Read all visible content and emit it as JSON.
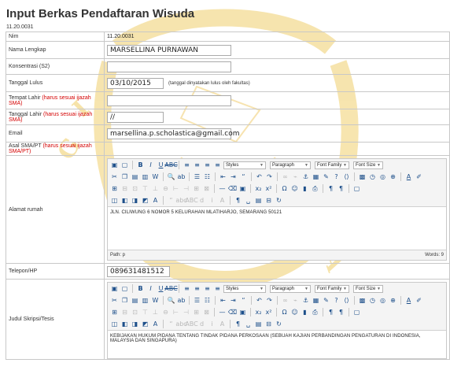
{
  "page": {
    "title": "Input Berkas Pendaftaran Wisuda",
    "id_line": "11.20.0031"
  },
  "form": {
    "nim": {
      "label": "Nim",
      "value": "11.20.0031"
    },
    "nama": {
      "label": "Nama Lengkap",
      "value": "MARSELLINA PURNAWAN"
    },
    "konsentrasi": {
      "label": "Konsentrasi (S2)",
      "value": ""
    },
    "tgl_lulus": {
      "label": "Tanggal Lulus",
      "value": "03/10/2015",
      "hint": "(tanggal dinyatakan lulus oleh fakultas)"
    },
    "tempat_lahir": {
      "label": "Tempat Lahir",
      "req": "(harus sesuai ijazah SMA)",
      "value": ""
    },
    "tanggal_lahir": {
      "label": "Tanggal Lahir",
      "req": "(harus sesuai ijazah SMA)",
      "value": "//"
    },
    "email": {
      "label": "Email",
      "value": "marsellina.p.scholastica@gmail.com"
    },
    "asal_sma": {
      "label": "Asal SMA/PT",
      "req": "(harus sesuai ijazah SMA/PT)"
    },
    "alamat": {
      "label": "Alamat rumah",
      "content": "JLN. CILIWUNG 6 NOMOR 5 KELURAHAN MLATIHARJO, SEMARANG 50121",
      "path": "Path: p",
      "words": "Words: 9"
    },
    "telepon": {
      "label": "Telepon/HP",
      "value": "089631481512"
    },
    "judul": {
      "label": "Judul Skripsi/Tesis",
      "content": "KEBIJAKAN HUKUM PIDANA TENTANG TINDAK PIDANA PERKOSAAN (SEBUAH KAJIAN PERBANDINGAN PENGATURAN DI INDONESIA, MALAYSIA DAN SINGAPURA)"
    }
  },
  "editor": {
    "styles": "Styles",
    "paragraph": "Paragraph",
    "font_family": "Font Family",
    "font_size": "Font Size"
  },
  "colors": {
    "watermark": "#f3d88a",
    "required": "#d40000",
    "toolbar_bg": "#f4f4f4"
  }
}
